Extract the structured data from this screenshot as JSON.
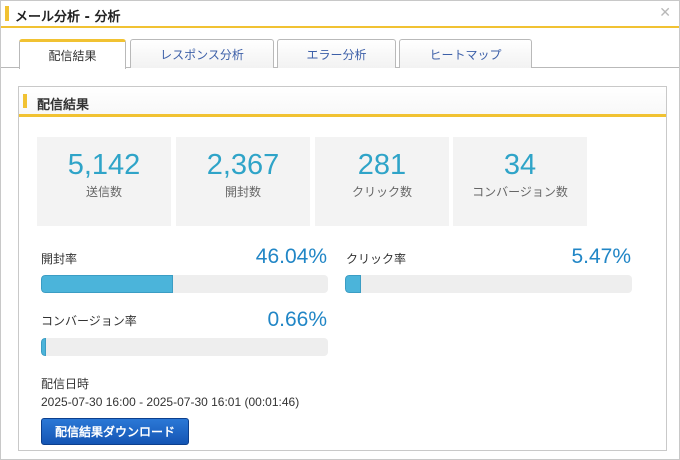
{
  "window": {
    "title": "メール分析 - 分析",
    "close_icon": "close-icon",
    "accent_color": "#f1c232"
  },
  "tabs": [
    {
      "label": "配信結果",
      "active": true
    },
    {
      "label": "レスポンス分析",
      "active": false
    },
    {
      "label": "エラー分析",
      "active": false
    },
    {
      "label": "ヒートマップ",
      "active": false
    }
  ],
  "panel": {
    "title": "配信結果"
  },
  "metrics": [
    {
      "value": "5,142",
      "label": "送信数"
    },
    {
      "value": "2,367",
      "label": "開封数"
    },
    {
      "value": "281",
      "label": "クリック数"
    },
    {
      "value": "34",
      "label": "コンバージョン数"
    }
  ],
  "rates": {
    "open": {
      "label": "開封率",
      "value": "46.04%",
      "fraction": 0.4604
    },
    "click": {
      "label": "クリック率",
      "value": "5.47%",
      "fraction": 0.0547
    },
    "conversion": {
      "label": "コンバージョン率",
      "value": "0.66%",
      "fraction": 0.0066
    }
  },
  "delivery": {
    "label": "配信日時",
    "value": "2025-07-30 16:00 - 2025-07-30 16:01 (00:01:46)"
  },
  "download": {
    "label": "配信結果ダウンロード"
  },
  "colors": {
    "metric_value": "#2fa4c8",
    "rate_value": "#2186c6",
    "bar_fill": "#4bb4da",
    "button": "#1f66c6"
  }
}
